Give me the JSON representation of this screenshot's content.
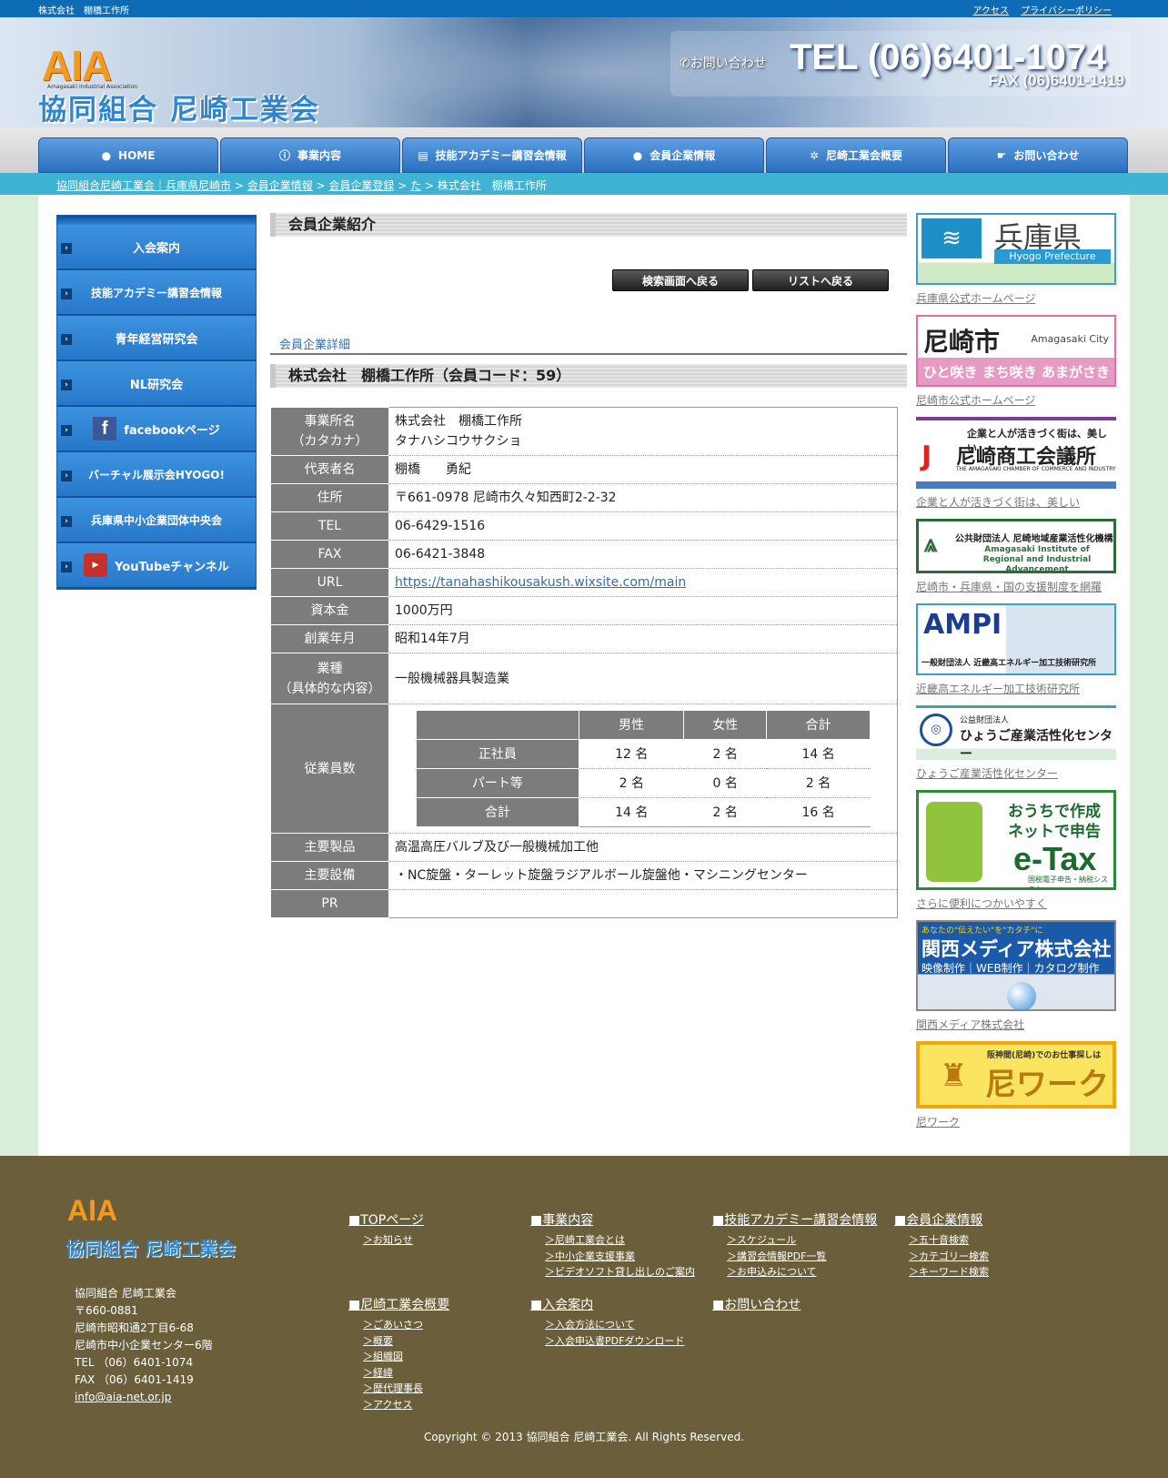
{
  "topbar": {
    "site_name": "株式会社　棚橋工作所",
    "links": [
      "アクセス",
      "プライバシーポリシー"
    ]
  },
  "header": {
    "logo_mark": "AIA",
    "logo_sub": "Amagasaki Industrial Association",
    "logo_name": "協同組合 尼崎工業会",
    "contact_label": "お問い合わせ",
    "tel": "TEL (06)6401-1074",
    "fax": "FAX (06)6401-1419"
  },
  "nav": [
    {
      "label": "HOME",
      "icon": "home-icon"
    },
    {
      "label": "事業内容",
      "icon": "info-icon"
    },
    {
      "label": "技能アカデミー講習会情報",
      "icon": "book-icon"
    },
    {
      "label": "会員企業情報",
      "icon": "chat-icon"
    },
    {
      "label": "尼崎工業会概要",
      "icon": "gear-icon"
    },
    {
      "label": "お問い合わせ",
      "icon": "hand-icon"
    }
  ],
  "breadcrumb": {
    "items": [
      "協同組合尼崎工業会｜兵庫県尼崎市",
      "会員企業情報",
      "会員企業登録",
      "た"
    ],
    "current": "株式会社　棚橋工作所",
    "sep": " > "
  },
  "sidebar": {
    "items": [
      "入会案内",
      "技能アカデミー講習会情報",
      "青年経営研究会",
      "NL研究会",
      "facebookページ",
      "バーチャル展示会HYOGO!",
      "兵庫県中小企業団体中央会",
      "YouTubeチャンネル"
    ]
  },
  "main": {
    "section_title": "会員企業紹介",
    "back_search": "検索画面へ戻る",
    "back_list": "リストへ戻る",
    "detail_link": "会員企業詳細",
    "company_heading": "株式会社　棚橋工作所（会員コード：59）",
    "rows": {
      "name_label_1": "事業所名",
      "name_label_2": "（カタカナ）",
      "name": "株式会社　棚橋工作所",
      "kana": "タナハシコウサクショ",
      "rep_label": "代表者名",
      "rep": "棚橋　　勇紀",
      "addr_label": "住所",
      "addr": "〒661-0978 尼崎市久々知西町2-2-32",
      "tel_label": "TEL",
      "tel": "06-6429-1516",
      "fax_label": "FAX",
      "fax": "06-6421-3848",
      "url_label": "URL",
      "url": "https://tanahashikousakush.wixsite.com/main",
      "capital_label": "資本金",
      "capital": "1000万円",
      "founded_label": "創業年月",
      "founded": "昭和14年7月",
      "industry_label_1": "業種",
      "industry_label_2": "（具体的な内容）",
      "industry": "一般機械器具製造業",
      "employees_label": "従業員数",
      "products_label": "主要製品",
      "products": "高温高圧バルブ及び一般機械加工他",
      "equipment_label": "主要設備",
      "equipment": "・NC旋盤・ターレット旋盤ラジアルボール旋盤他・マシニングセンター",
      "pr_label": "PR",
      "pr": ""
    },
    "employees": {
      "headers": [
        "",
        "男性",
        "女性",
        "合計"
      ],
      "rows": [
        {
          "label": "正社員",
          "male": "12 名",
          "female": "2 名",
          "total": "14 名"
        },
        {
          "label": "パート等",
          "male": "2 名",
          "female": "0 名",
          "total": "2 名"
        },
        {
          "label": "合計",
          "male": "14 名",
          "female": "2 名",
          "total": "16 名"
        }
      ]
    }
  },
  "banners": [
    {
      "title": "兵庫県",
      "sub": "Hyogo Prefecture",
      "caption": "兵庫県公式ホームページ"
    },
    {
      "title": "尼崎市",
      "sub": "Amagasaki City",
      "sub2": "ひと咲き まち咲き あまがさき",
      "caption": "尼崎市公式ホームページ"
    },
    {
      "title": "尼崎商工会議所",
      "sub": "企業と人が活きづく街は、美しい",
      "sub2": "THE AMAGASAKI CHAMBER OF COMMERCE AND INDUSTRY",
      "caption": "企業と人が活きづく街は、美しい"
    },
    {
      "title": "公共財団法人 尼崎地域産業活性化機構",
      "sub": "Amagasaki Institute of Regional and Industrial Advancement",
      "caption": "尼崎市・兵庫県・国の支援制度を網羅"
    },
    {
      "title": "AMPI",
      "sub": "一般財団法人 近畿高エネルギー加工技術研究所",
      "caption": "近畿高エネルギー加工技術研究所"
    },
    {
      "title": "ひょうご産業活性化センター",
      "sub": "公益財団法人",
      "caption": "ひょうご産業活性化センター"
    },
    {
      "title": "e-Tax",
      "sub": "おうちで作成 ネットで申告",
      "sub2": "国税電子申告・納税システム",
      "caption": "さらに便利につかいやすく"
    },
    {
      "title": "関西メディア株式会社",
      "sub": "あなたの\"伝えたい\"を\"カタチ\"に",
      "sub2": "映像制作｜WEB制作｜カタログ制作",
      "caption": "関西メディア株式会社"
    },
    {
      "title": "尼ワーク",
      "sub": "阪神間(尼崎)でのお仕事探しは",
      "caption": "尼ワーク"
    }
  ],
  "footer": {
    "logo_mark": "AIA",
    "logo_name": "協同組合 尼崎工業会",
    "address": [
      "協同組合 尼崎工業会",
      "〒660-0881",
      "尼崎市昭和通2丁目6-68",
      "尼崎市中小企業センター6階",
      "TEL （06）6401-1074",
      "FAX （06）6401-1419"
    ],
    "email": "info@aia-net.or.jp",
    "cols": [
      {
        "title": "■TOPページ",
        "items": [
          "＞お知らせ"
        ]
      },
      {
        "title": "■事業内容",
        "items": [
          "＞尼崎工業会とは",
          "＞中小企業支援事業",
          "＞ビデオソフト貸し出しのご案内"
        ]
      },
      {
        "title": "■技能アカデミー講習会情報",
        "items": [
          "＞スケジュール",
          "＞講習会情報PDF一覧",
          "＞お申込みについて"
        ]
      },
      {
        "title": "■会員企業情報",
        "items": [
          "＞五十音検索",
          "＞カテゴリー検索",
          "＞キーワード検索"
        ]
      },
      {
        "title": "■尼崎工業会概要",
        "items": [
          "＞ごあいさつ",
          "＞概要",
          "＞組織図",
          "＞経緯",
          "＞歴代理事長",
          "＞アクセス"
        ]
      },
      {
        "title": "■入会案内",
        "items": [
          "＞入会方法について",
          "＞入会申込書PDFダウンロード"
        ]
      },
      {
        "title": "■お問い合わせ",
        "items": []
      }
    ],
    "copyright": "Copyright © 2013 協同組合 尼崎工業会. All Rights Reserved."
  },
  "colors": {
    "blue": "#0d6cb5",
    "cyan": "#3fb3d4",
    "footer": "#6a5f3a",
    "orange": "#f39a1e"
  }
}
